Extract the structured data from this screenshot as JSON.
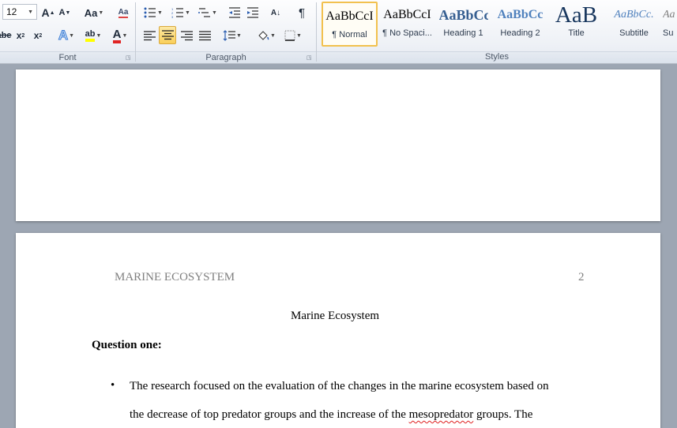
{
  "ribbon": {
    "font_group": {
      "font_size": "12",
      "grow_font": "A",
      "shrink_font": "A",
      "change_case": "Aa",
      "clear_formatting": "Aa",
      "strike": "abe",
      "subscript": "x",
      "superscript": "x",
      "text_effects": "A",
      "highlight": "ab",
      "font_color": "A",
      "label": "Font"
    },
    "paragraph_group": {
      "sort_glyph": "A↓",
      "pilcrow": "¶",
      "label": "Paragraph"
    },
    "styles_group": {
      "label": "Styles",
      "tiles": [
        {
          "sample": "AaBbCcI",
          "name": "¶ Normal"
        },
        {
          "sample": "AaBbCcI",
          "name": "¶ No Spaci..."
        },
        {
          "sample": "AaBbCc",
          "name": "Heading 1"
        },
        {
          "sample": "AaBbCc",
          "name": "Heading 2"
        },
        {
          "sample": "AaB",
          "name": "Title"
        },
        {
          "sample": "AaBbCc.",
          "name": "Subtitle"
        },
        {
          "sample": "Aa",
          "name": "Su"
        }
      ]
    }
  },
  "document": {
    "running_head": "MARINE ECOSYSTEM",
    "page_number": "2",
    "title": "Marine Ecosystem",
    "question_heading": "Question one:",
    "bullet": "•",
    "bullet_line1": "The research focused on the evaluation of the changes in the marine ecosystem based on",
    "bullet_line2_a": "the decrease of top predator groups and the increase of the ",
    "bullet_line2_misspelled": "mesopredator",
    "bullet_line2_b": " groups.  The"
  },
  "colors": {
    "accent_selection": "#f9cf5a",
    "heading_blue": "#2e5e8e",
    "spellcheck": "#e02020"
  }
}
